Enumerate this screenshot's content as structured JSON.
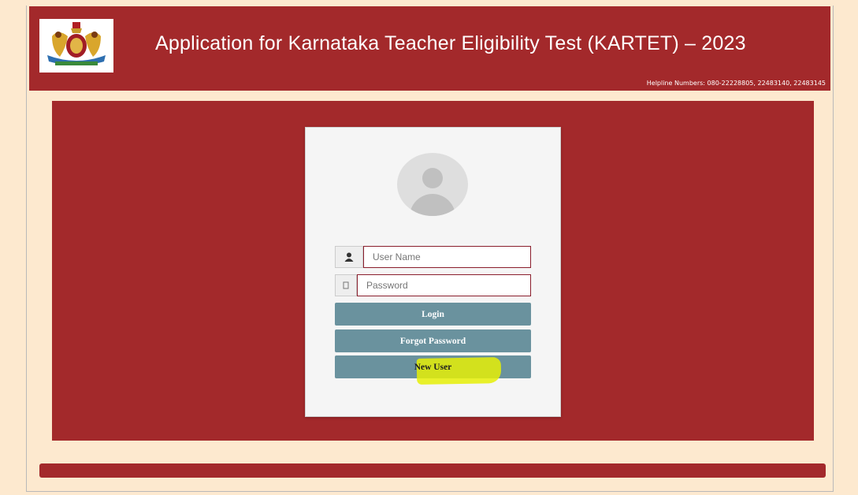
{
  "header": {
    "title": "Application for Karnataka Teacher Eligibility Test (KARTET) – 2023",
    "helpline": "Helpline Numbers: 080-22228805, 22483140, 22483145",
    "emblem_icon": "karnataka-state-emblem"
  },
  "login": {
    "avatar_icon": "user-avatar-icon",
    "username_placeholder": "User Name",
    "password_placeholder": "Password",
    "login_label": "Login",
    "forgot_label": "Forgot Password",
    "new_user_label": "New User"
  },
  "colors": {
    "header_bg": "#a3292b",
    "page_bg": "#fde9cf",
    "button_bg": "#6a929e",
    "highlight": "#e5ee06"
  }
}
